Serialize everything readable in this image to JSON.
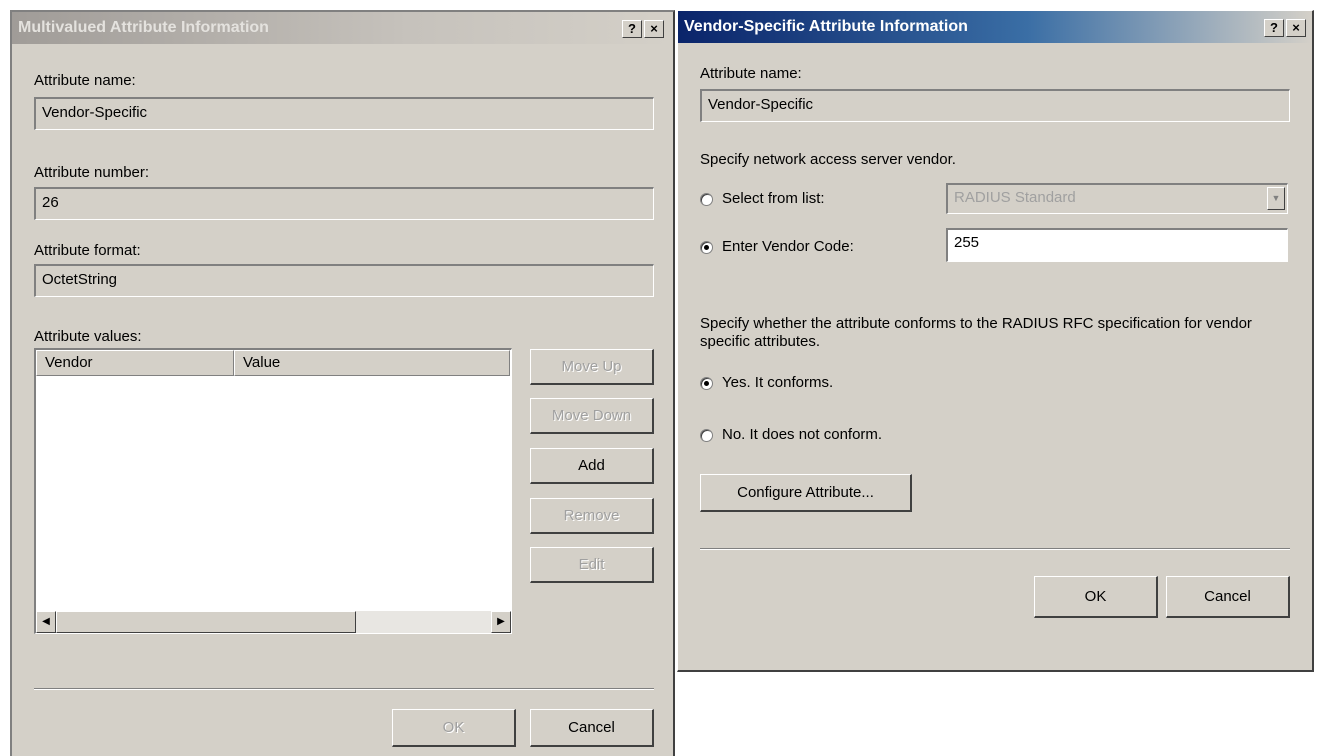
{
  "left_dialog": {
    "title": "Multivalued Attribute Information",
    "help_glyph": "?",
    "close_glyph": "×",
    "attribute_name_label": "Attribute name:",
    "attribute_name_value": "Vendor-Specific",
    "attribute_number_label": "Attribute number:",
    "attribute_number_value": "26",
    "attribute_format_label": "Attribute format:",
    "attribute_format_value": "OctetString",
    "attribute_values_label": "Attribute values:",
    "columns": [
      "Vendor",
      "Value"
    ],
    "buttons": {
      "move_up": "Move Up",
      "move_down": "Move Down",
      "add": "Add",
      "remove": "Remove",
      "edit": "Edit",
      "ok": "OK",
      "cancel": "Cancel"
    },
    "scroll_left_glyph": "◀",
    "scroll_right_glyph": "▶"
  },
  "right_dialog": {
    "title": "Vendor-Specific Attribute Information",
    "help_glyph": "?",
    "close_glyph": "×",
    "attribute_name_label": "Attribute name:",
    "attribute_name_value": "Vendor-Specific",
    "vendor_prompt": "Specify network access server vendor.",
    "select_from_list_label": "Select from list:",
    "select_from_list_value": "RADIUS Standard",
    "dropdown_glyph": "▼",
    "enter_vendor_code_label": "Enter Vendor Code:",
    "vendor_code_value": "255",
    "conform_prompt": "Specify whether the attribute conforms to the RADIUS RFC specification for vendor specific attributes.",
    "yes_label": "Yes. It conforms.",
    "no_label": "No. It does not conform.",
    "configure_button": "Configure Attribute...",
    "ok": "OK",
    "cancel": "Cancel",
    "selected_vendor_option": "Enter Vendor Code",
    "selected_conform_option": "Yes. It conforms."
  }
}
